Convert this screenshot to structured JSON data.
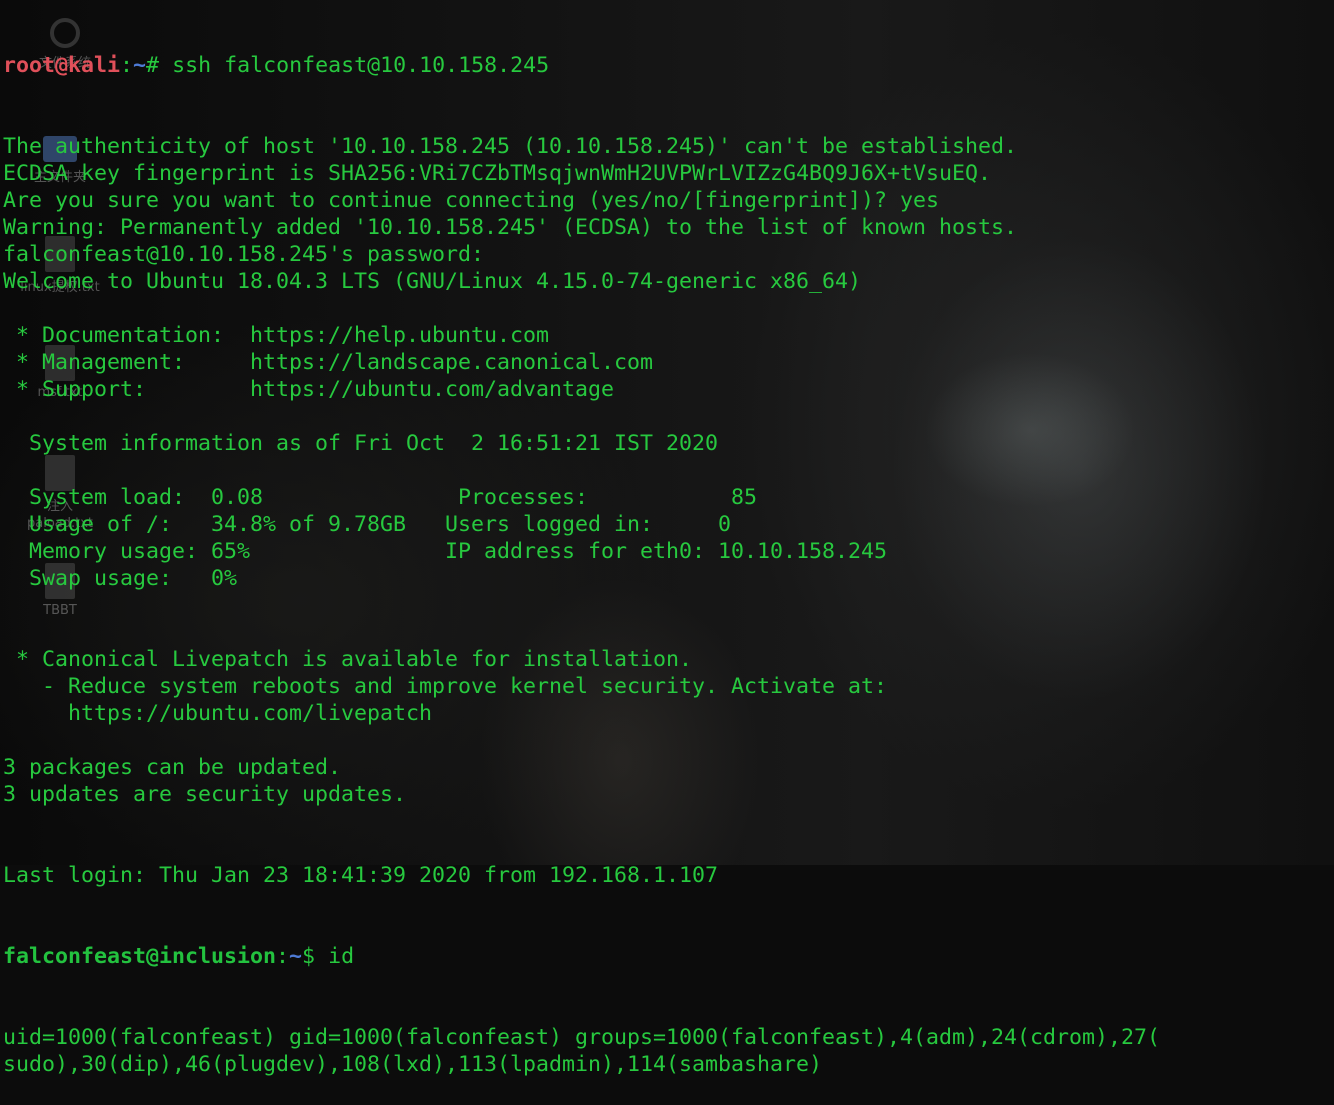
{
  "desktop": {
    "icons": [
      {
        "label": "文件系统",
        "icon": "magnifier-icon"
      },
      {
        "label": "主文件夹",
        "icon": "folder-icon"
      },
      {
        "label": "linux提权.txt",
        "icon": "document-icon"
      },
      {
        "label": "msf.txt",
        "icon": "document-icon"
      },
      {
        "label": "注入",
        "icon": "document-icon"
      },
      {
        "label": "paload.txt",
        "icon": "document-icon"
      },
      {
        "label": "TBBT",
        "icon": "document-icon"
      }
    ]
  },
  "terminal": {
    "prompt1": {
      "user": "root@kali",
      "sep": ":",
      "path": "~",
      "sym": "# ",
      "cmd": "ssh falconfeast@10.10.158.245"
    },
    "lines": [
      "The authenticity of host '10.10.158.245 (10.10.158.245)' can't be established.",
      "ECDSA key fingerprint is SHA256:VRi7CZbTMsqjwnWmH2UVPWrLVIZzG4BQ9J6X+tVsuEQ.",
      "Are you sure you want to continue connecting (yes/no/[fingerprint])? yes",
      "Warning: Permanently added '10.10.158.245' (ECDSA) to the list of known hosts.",
      "falconfeast@10.10.158.245's password: ",
      "Welcome to Ubuntu 18.04.3 LTS (GNU/Linux 4.15.0-74-generic x86_64)",
      "",
      " * Documentation:  https://help.ubuntu.com",
      " * Management:     https://landscape.canonical.com",
      " * Support:        https://ubuntu.com/advantage",
      "",
      "  System information as of Fri Oct  2 16:51:21 IST 2020",
      "",
      "  System load:  0.08               Processes:           85",
      "  Usage of /:   34.8% of 9.78GB   Users logged in:     0",
      "  Memory usage: 65%               IP address for eth0: 10.10.158.245",
      "  Swap usage:   0%",
      "",
      "",
      " * Canonical Livepatch is available for installation.",
      "   - Reduce system reboots and improve kernel security. Activate at:",
      "     https://ubuntu.com/livepatch",
      "",
      "3 packages can be updated.",
      "3 updates are security updates.",
      "",
      "",
      "Last login: Thu Jan 23 18:41:39 2020 from 192.168.1.107"
    ],
    "prompt2": {
      "user": "falconfeast@inclusion",
      "sep": ":",
      "path": "~",
      "sym": "$ ",
      "cmd": "id"
    },
    "output": [
      "uid=1000(falconfeast) gid=1000(falconfeast) groups=1000(falconfeast),4(adm),24(cdrom),27(",
      "sudo),30(dip),46(plugdev),108(lxd),113(lpadmin),114(sambashare)"
    ]
  },
  "colors": {
    "text": "#27c93f",
    "root_prompt": "#e0505a",
    "user_prompt": "#23c23f",
    "path": "#4e7bd6",
    "background": "#0c0c0c"
  }
}
